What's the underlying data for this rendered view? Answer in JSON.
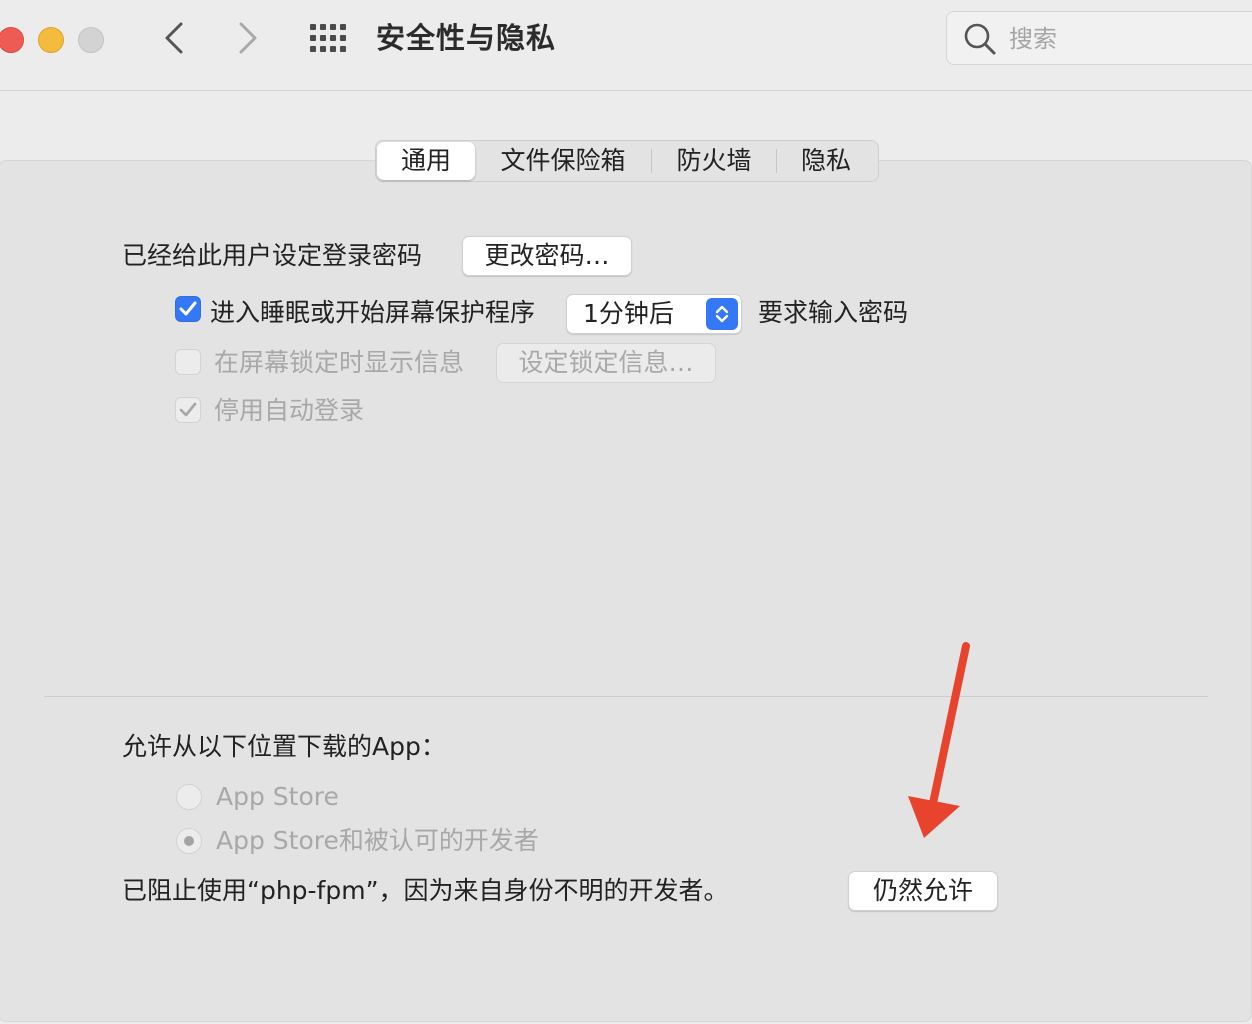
{
  "window": {
    "title": "安全性与隐私"
  },
  "search": {
    "placeholder": "搜索"
  },
  "tabs": [
    {
      "label": "通用",
      "active": true
    },
    {
      "label": "文件保险箱",
      "active": false
    },
    {
      "label": "防火墙",
      "active": false
    },
    {
      "label": "隐私",
      "active": false
    }
  ],
  "general": {
    "password_label": "已经给此用户设定登录密码",
    "change_password_button": "更改密码…",
    "sleep": {
      "checked": true,
      "label": "进入睡眠或开始屏幕保护程序",
      "delay_value": "1分钟后",
      "suffix": "要求输入密码"
    },
    "lock_message": {
      "checked": false,
      "enabled": false,
      "label": "在屏幕锁定时显示信息",
      "button": "设定锁定信息…"
    },
    "disable_auto_login": {
      "checked": true,
      "enabled": false,
      "label": "停用自动登录"
    }
  },
  "downloads": {
    "heading": "允许从以下位置下载的App：",
    "options": [
      {
        "label": "App Store",
        "selected": false
      },
      {
        "label": "App Store和被认可的开发者",
        "selected": true
      }
    ],
    "blocked_message": "已阻止使用“php-fpm”，因为来自身份不明的开发者。",
    "allow_anyway_button": "仍然允许"
  },
  "colors": {
    "accent": "#3478f6",
    "annotation_arrow": "#e8432d"
  }
}
